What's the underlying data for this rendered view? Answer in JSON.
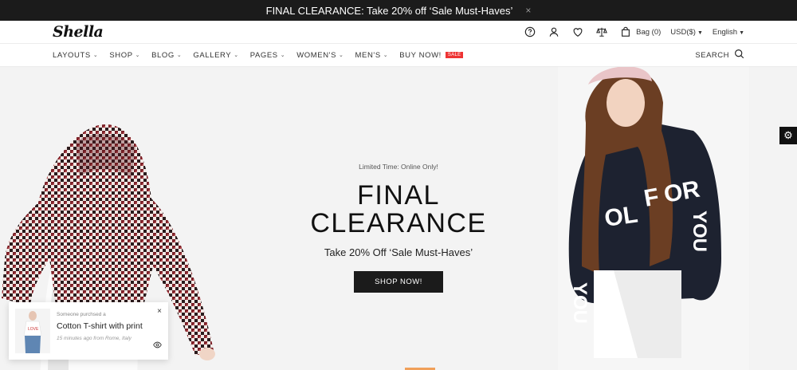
{
  "announcement": {
    "text": "FINAL CLEARANCE: Take 20% off ‘Sale Must-Haves’",
    "close_glyph": "×"
  },
  "header": {
    "logo": "Shella",
    "bag_label": "Bag (0)",
    "currency": "USD($)",
    "language": "English",
    "icons": [
      "help-icon",
      "user-icon",
      "heart-icon",
      "compare-icon",
      "bag-icon"
    ]
  },
  "nav": {
    "items": [
      {
        "label": "LAYOUTS"
      },
      {
        "label": "SHOP"
      },
      {
        "label": "BLOG"
      },
      {
        "label": "GALLERY"
      },
      {
        "label": "PAGES"
      },
      {
        "label": "WOMEN'S"
      },
      {
        "label": "MEN'S"
      },
      {
        "label": "BUY NOW!"
      }
    ],
    "sale_badge": "SALE",
    "search_label": "SEARCH"
  },
  "hero": {
    "eyebrow": "Limited Time: Online Only!",
    "headline_line1": "FINAL",
    "headline_line2": "CLEARANCE",
    "subline": "Take 20% Off ‘Sale Must-Haves’",
    "cta": "SHOP NOW!"
  },
  "popup": {
    "intro": "Someone purchsed a",
    "product": "Cotton T-shirt with print",
    "meta": "15 minutes ago from Rome, Italy",
    "close_glyph": "×"
  },
  "colors": {
    "topbar_bg": "#1b1b1b",
    "sale_badge": "#e33333",
    "hero_bg": "#f3f3f3",
    "cta_bg": "#1b1b1b"
  }
}
